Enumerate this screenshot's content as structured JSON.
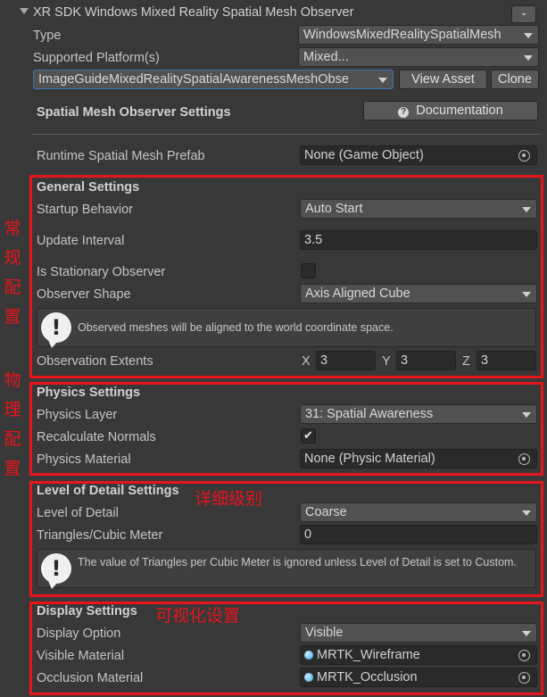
{
  "header": {
    "title": "XR SDK Windows Mixed Reality Spatial Mesh Observer",
    "collapse_label": "-"
  },
  "top": {
    "type_label": "Type",
    "type_value": "WindowsMixedRealitySpatialMesh",
    "platforms_label": "Supported Platform(s)",
    "platforms_value": "Mixed...",
    "profile_value": "ImageGuideMixedRealitySpatialAwarenessMeshObse",
    "view_asset_label": "View Asset",
    "clone_label": "Clone",
    "settings_title": "Spatial Mesh Observer Settings",
    "documentation_label": "Documentation",
    "prefab_label": "Runtime Spatial Mesh Prefab",
    "prefab_value": "None (Game Object)"
  },
  "general": {
    "title": "General Settings",
    "startup_label": "Startup Behavior",
    "startup_value": "Auto Start",
    "update_label": "Update Interval",
    "update_value": "3.5",
    "stationary_label": "Is Stationary Observer",
    "stationary_checked": false,
    "shape_label": "Observer Shape",
    "shape_value": "Axis Aligned Cube",
    "help_text": "Observed meshes will be aligned to the world coordinate space.",
    "extents_label": "Observation Extents",
    "x_label": "X",
    "x_value": "3",
    "y_label": "Y",
    "y_value": "3",
    "z_label": "Z",
    "z_value": "3"
  },
  "physics": {
    "title": "Physics Settings",
    "layer_label": "Physics Layer",
    "layer_value": "31: Spatial Awareness",
    "normals_label": "Recalculate Normals",
    "normals_checked": true,
    "material_label": "Physics Material",
    "material_value": "None (Physic Material)"
  },
  "lod": {
    "title": "Level of Detail Settings",
    "lod_label": "Level of Detail",
    "lod_value": "Coarse",
    "triangles_label": "Triangles/Cubic Meter",
    "triangles_value": "0",
    "help_text": "The value of Triangles per Cubic Meter is ignored unless Level of Detail is set to Custom."
  },
  "display": {
    "title": "Display Settings",
    "option_label": "Display Option",
    "option_value": "Visible",
    "visible_label": "Visible Material",
    "visible_value": "MRTK_Wireframe",
    "occlusion_label": "Occlusion Material",
    "occlusion_value": "MRTK_Occlusion"
  },
  "annotations": {
    "general_cn": "常规配置",
    "physics_cn": "物理配置",
    "lod_cn": "详细级别",
    "display_cn": "可视化设置",
    "color": "#e8141c"
  },
  "icons": {
    "foldout": "triangle-down-icon",
    "help": "question-icon",
    "warning": "exclamation-icon",
    "picker": "object-picker-icon",
    "material": "material-sphere-icon"
  }
}
